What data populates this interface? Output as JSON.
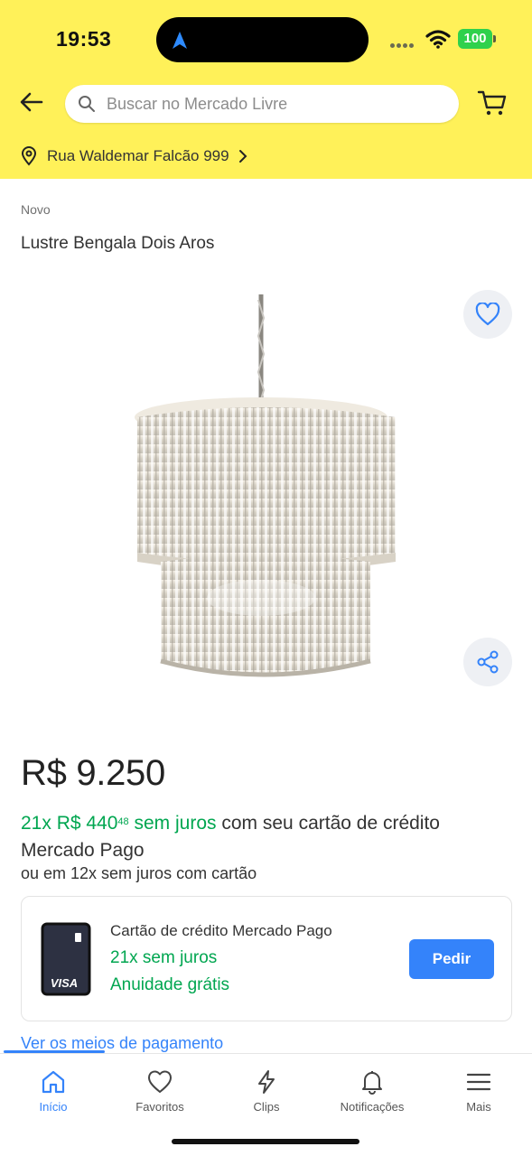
{
  "status_bar": {
    "time": "19:53",
    "battery": "100"
  },
  "search": {
    "placeholder": "Buscar no Mercado Livre"
  },
  "address": {
    "text": "Rua Waldemar Falcão 999"
  },
  "product": {
    "condition": "Novo",
    "title": "Lustre Bengala Dois Aros",
    "price": "R$ 9.250",
    "installments_green_prefix": "21x R$ 440",
    "installments_cents": "48",
    "installments_green_suffix": " sem juros",
    "installments_rest": " com seu cartão de crédito Mercado Pago",
    "alt_installments": "ou em 12x sem juros com cartão"
  },
  "credit_card_offer": {
    "card_brand": "VISA",
    "title": "Cartão de crédito Mercado Pago",
    "line1": "21x sem juros",
    "line2": "Anuidade grátis",
    "button_label": "Pedir"
  },
  "payment_link": "Ver os meios de pagamento",
  "bottom_nav": {
    "items": [
      {
        "label": "Início",
        "icon": "home-icon",
        "active": true
      },
      {
        "label": "Favoritos",
        "icon": "heart-icon",
        "active": false
      },
      {
        "label": "Clips",
        "icon": "lightning-icon",
        "active": false
      },
      {
        "label": "Notificações",
        "icon": "bell-icon",
        "active": false
      },
      {
        "label": "Mais",
        "icon": "menu-icon",
        "active": false
      }
    ]
  },
  "colors": {
    "header_yellow": "#fff159",
    "accent_blue": "#3483fa",
    "green": "#00a650"
  }
}
